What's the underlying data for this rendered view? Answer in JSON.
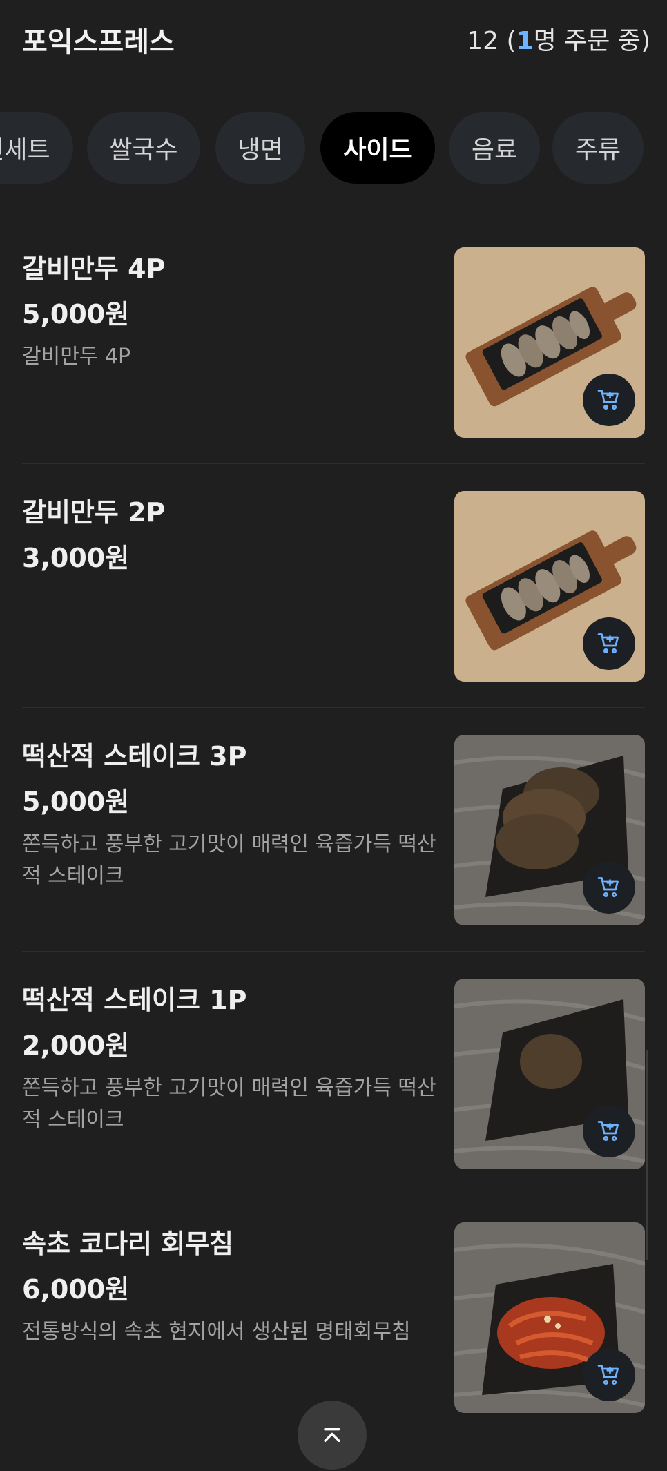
{
  "header": {
    "store_name": "포익스프레스",
    "order_status_prefix": "12 (",
    "order_status_count": "1",
    "order_status_suffix": "명 주문 중)"
  },
  "tabs": [
    {
      "label": "런세트",
      "active": false
    },
    {
      "label": "쌀국수",
      "active": false
    },
    {
      "label": "냉면",
      "active": false
    },
    {
      "label": "사이드",
      "active": true
    },
    {
      "label": "음료",
      "active": false
    },
    {
      "label": "주류",
      "active": false
    }
  ],
  "menu_items": [
    {
      "name": "갈비만두 4P",
      "price": "5,000원",
      "description": "갈비만두 4P",
      "image": "dumplings-on-board"
    },
    {
      "name": "갈비만두 2P",
      "price": "3,000원",
      "description": "",
      "image": "dumplings-on-board"
    },
    {
      "name": "떡산적 스테이크 3P",
      "price": "5,000원",
      "description": "쫀득하고 풍부한 고기맛이 매력인 육즙가득 떡산적 스테이크",
      "image": "three-patties-on-plate"
    },
    {
      "name": "떡산적 스테이크 1P",
      "price": "2,000원",
      "description": "쫀득하고 풍부한 고기맛이 매력인 육즙가득 떡산적 스테이크",
      "image": "single-patty-on-plate"
    },
    {
      "name": "속초 코다리 회무침",
      "price": "6,000원",
      "description": "전통방식의 속초 현지에서 생산된 명태회무침",
      "image": "spicy-fish-salad-on-plate"
    }
  ],
  "icons": {
    "cart": "cart-add-icon",
    "scroll_top": "chevron-up-icon"
  },
  "colors": {
    "background": "#1f1f1f",
    "accent": "#6fb3ff",
    "active_tab": "#000000",
    "inactive_tab": "#262a2f"
  }
}
